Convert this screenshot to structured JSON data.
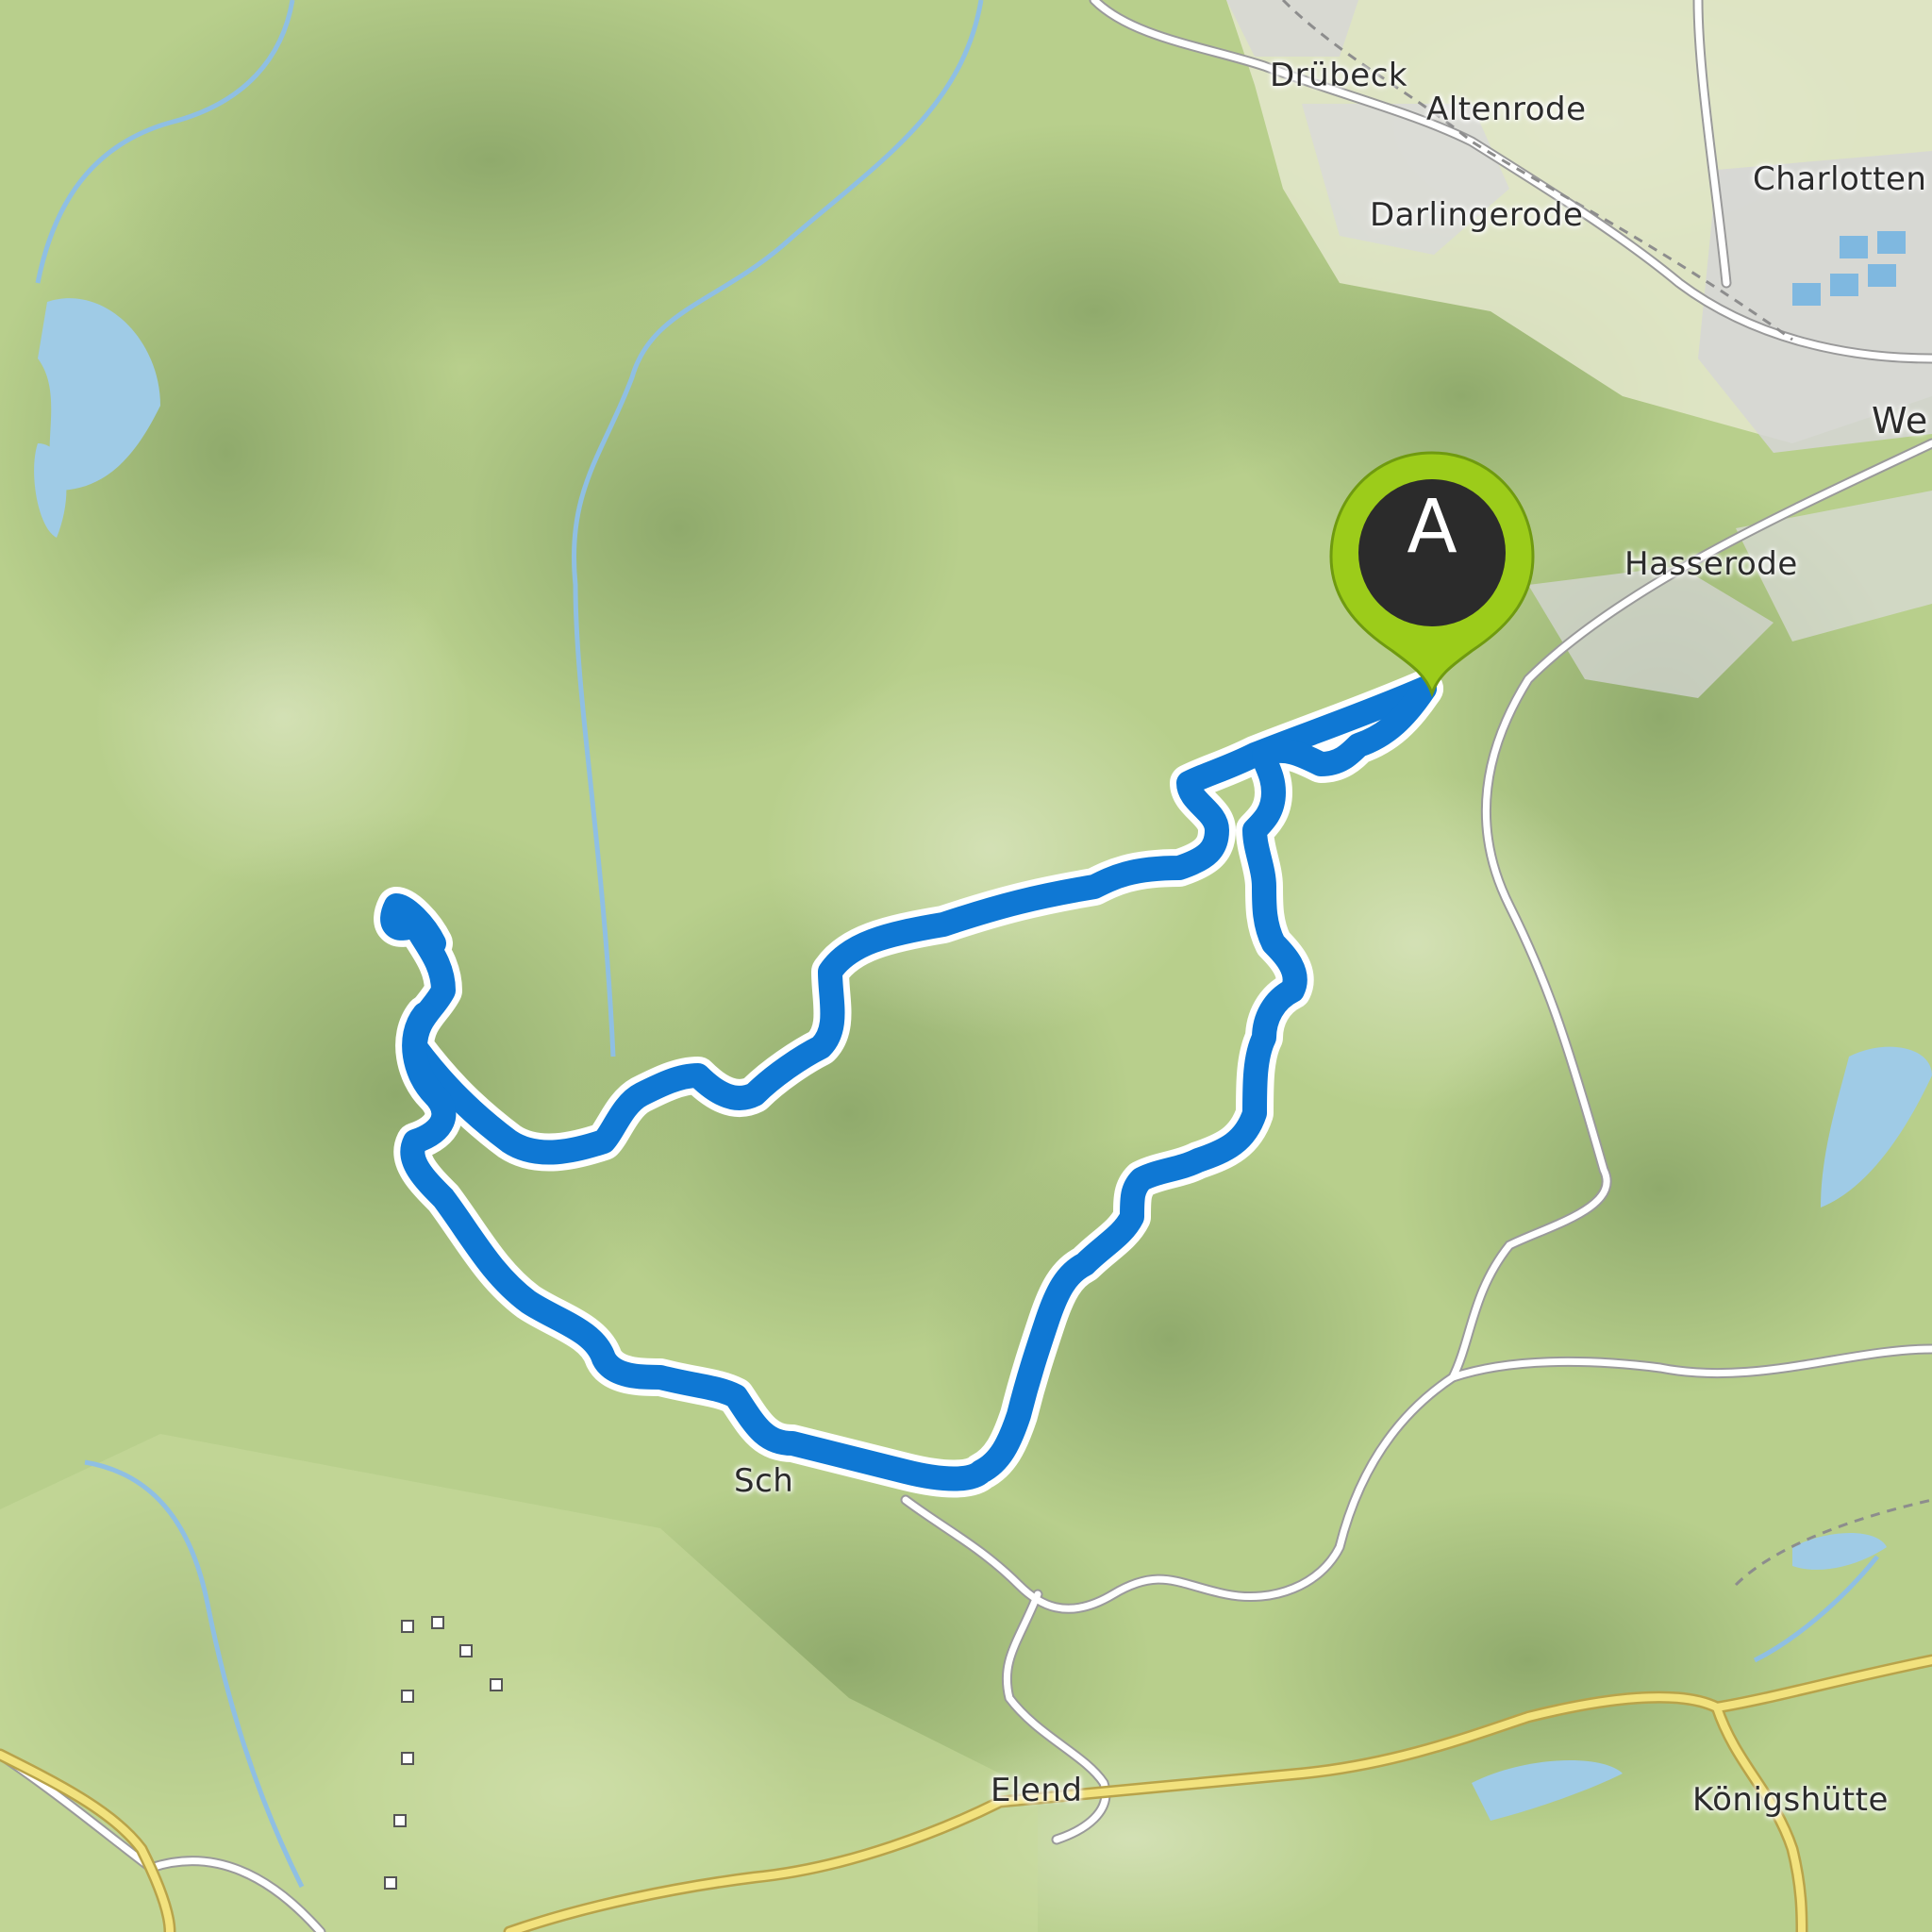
{
  "map": {
    "labels": {
      "drubeck": "Drübeck",
      "altenrode": "Altenrode",
      "charlotten": "Charlotten",
      "darlingerode": "Darlingerode",
      "we": "We",
      "hasserode": "Hasserode",
      "elend": "Elend",
      "konigshutte": "Königshütte",
      "sch": "Sch"
    },
    "route": {
      "color": "#0f78d4",
      "outline": "#ffffff"
    },
    "start_marker": {
      "letter": "A",
      "pin_color": "#9ccc1a",
      "inner_color": "#2b2b2b"
    }
  }
}
